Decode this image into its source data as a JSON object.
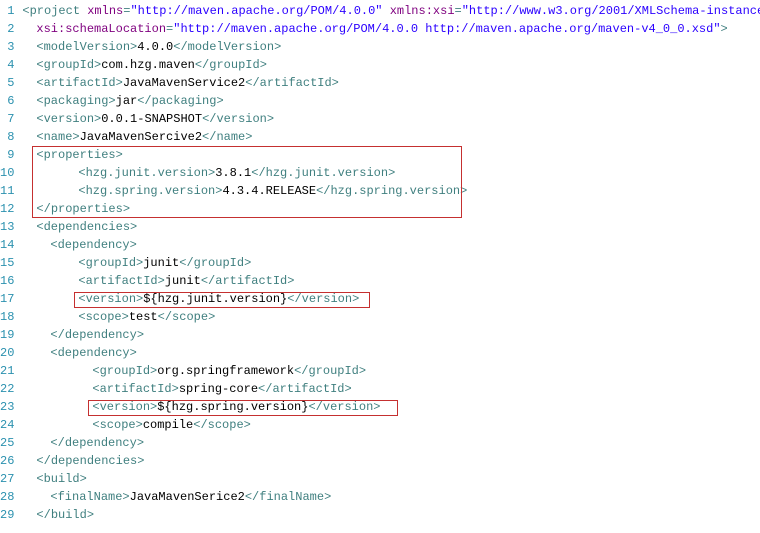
{
  "lineCount": 29,
  "xml": {
    "projectOpen": "project",
    "nsAttr": "xmlns",
    "nsVal": "http://maven.apache.org/POM/4.0.0",
    "xsiAttr": "xmlns:xsi",
    "xsiVal": "http://www.w3.org/2001/XMLSchema-instance",
    "schemaAttr": "xsi:schemaLocation",
    "schemaVal": "http://maven.apache.org/POM/4.0.0 http://maven.apache.org/maven-v4_0_0.xsd",
    "modelVersionTag": "modelVersion",
    "modelVersionVal": "4.0.0",
    "groupIdTag": "groupId",
    "groupIdVal": "com.hzg.maven",
    "artifactIdTag": "artifactId",
    "artifactIdVal": "JavaMavenService2",
    "packagingTag": "packaging",
    "packagingVal": "jar",
    "versionTag": "version",
    "versionVal": "0.0.1-SNAPSHOT",
    "nameTag": "name",
    "nameVal": "JavaMavenSercive2",
    "propertiesTag": "properties",
    "junitVerTag": "hzg.junit.version",
    "junitVerVal": "3.8.1",
    "springVerTag": "hzg.spring.version",
    "springVerVal": "4.3.4.RELEASE",
    "dependenciesTag": "dependencies",
    "dependencyTag": "dependency",
    "dep1GroupVal": "junit",
    "dep1ArtifactVal": "junit",
    "dep1VersionVal": "${hzg.junit.version}",
    "scopeTag": "scope",
    "dep1ScopeVal": "test",
    "dep2GroupVal": "org.springframework",
    "dep2ArtifactVal": "spring-core",
    "dep2VersionVal": "${hzg.spring.version}",
    "dep2ScopeVal": "compile",
    "buildTag": "build",
    "finalNameTag": "finalName",
    "finalNameVal": "JavaMavenSerice2"
  }
}
